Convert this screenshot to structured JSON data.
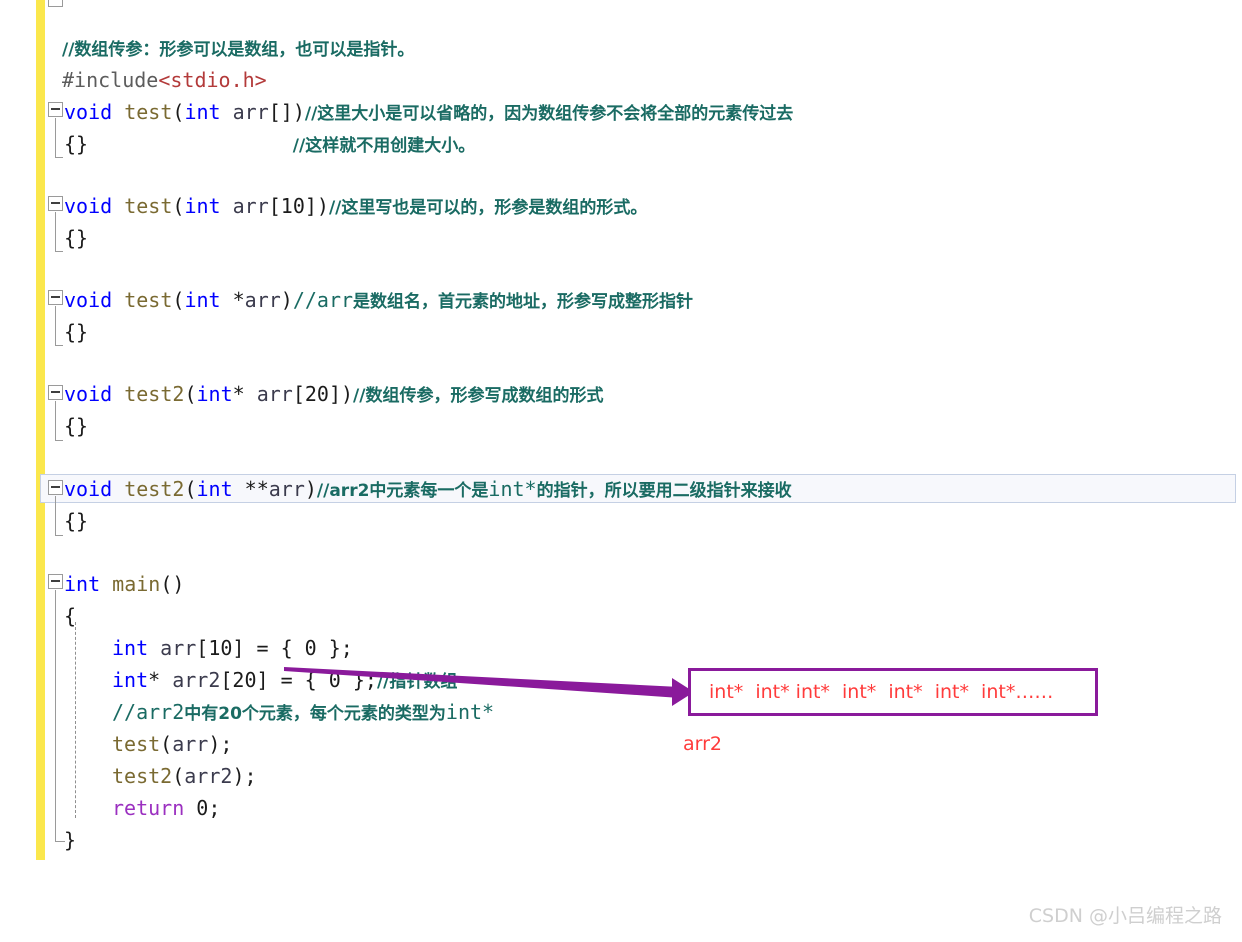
{
  "editor": {
    "change_bar_color": "#fbe74c",
    "current_line_index": 13,
    "background_color": "#ffffff",
    "lines": [
      {
        "indent": 0,
        "text": "//数组传参：形参可以是数组，也可以是指针。"
      },
      {
        "indent": 0,
        "text": "#include<stdio.h>"
      },
      {
        "indent": 0,
        "text": "void test(int arr[])//这里大小是可以省略的，因为数组传参不会将全部的元素传过去"
      },
      {
        "indent": 0,
        "text": "{}                  //这样就不用创建大小。"
      },
      {
        "indent": 0,
        "text": ""
      },
      {
        "indent": 0,
        "text": "void test(int arr[10])//这里写也是可以的，形参是数组的形式。"
      },
      {
        "indent": 0,
        "text": "{}"
      },
      {
        "indent": 0,
        "text": ""
      },
      {
        "indent": 0,
        "text": "void test(int *arr)//arr是数组名，首元素的地址，形参写成整形指针"
      },
      {
        "indent": 0,
        "text": "{}"
      },
      {
        "indent": 0,
        "text": ""
      },
      {
        "indent": 0,
        "text": "void test2(int* arr[20])//数组传参，形参写成数组的形式"
      },
      {
        "indent": 0,
        "text": "{}"
      },
      {
        "indent": 0,
        "text": "void test2(int **arr)//arr2中元素每一个是int*的指针，所以要用二级指针来接收"
      },
      {
        "indent": 0,
        "text": "{}"
      },
      {
        "indent": 0,
        "text": ""
      },
      {
        "indent": 0,
        "text": "int main()"
      },
      {
        "indent": 0,
        "text": "{"
      },
      {
        "indent": 1,
        "text": "int arr[10] = { 0 };"
      },
      {
        "indent": 1,
        "text": "int* arr2[20] = { 0 };//指针数组"
      },
      {
        "indent": 1,
        "text": "//arr2中有20个元素，每个元素的类型为int*"
      },
      {
        "indent": 1,
        "text": "test(arr);"
      },
      {
        "indent": 1,
        "text": "test2(arr2);"
      },
      {
        "indent": 1,
        "text": "return 0;"
      },
      {
        "indent": 0,
        "text": "}"
      }
    ],
    "tokens": {
      "comment_l1": "//数组传参：形参可以是数组，也可以是指针。",
      "preproc": "#include",
      "include_target": "<stdio.h>",
      "kw_void": "void",
      "kw_int": "int",
      "kw_return": "return",
      "fn_test": "test",
      "fn_test2": "test2",
      "fn_main": "main",
      "id_arr": "arr",
      "id_arr2": "arr2",
      "comment_test_arr": "//这里大小是可以省略的，因为数组传参不会将全部的元素传过去",
      "comment_no_size": "//这样就不用创建大小。",
      "comment_test_arr10": "//这里写也是可以的，形参是数组的形式。",
      "comment_test_ptr_a": "//arr",
      "comment_test_ptr_b": "是数组名，首元素的地址，形参写成整形指针",
      "comment_test2_arr20": "//数组传参，形参写成数组的形式",
      "comment_test2_pp_a": "//arr2中元素每一个是",
      "comment_test2_pp_b": "int*",
      "comment_test2_pp_c": "的指针，所以要用二级指针来接收",
      "comment_ptr_array": "//指针数组",
      "comment_arr2_elems_a": "//arr2",
      "comment_arr2_elems_b": "中有20个元素，每个元素的类型为",
      "comment_arr2_elems_c": "int*"
    }
  },
  "annotation": {
    "box_border_color": "#8a1a9b",
    "box_text": "int*  int* int*  int*  int*  int*  int*……",
    "box_text_color": "#ff3b3b",
    "label": "arr2",
    "arrow_color": "#8a1a9b"
  },
  "watermark": {
    "text": "CSDN @小吕编程之路"
  }
}
